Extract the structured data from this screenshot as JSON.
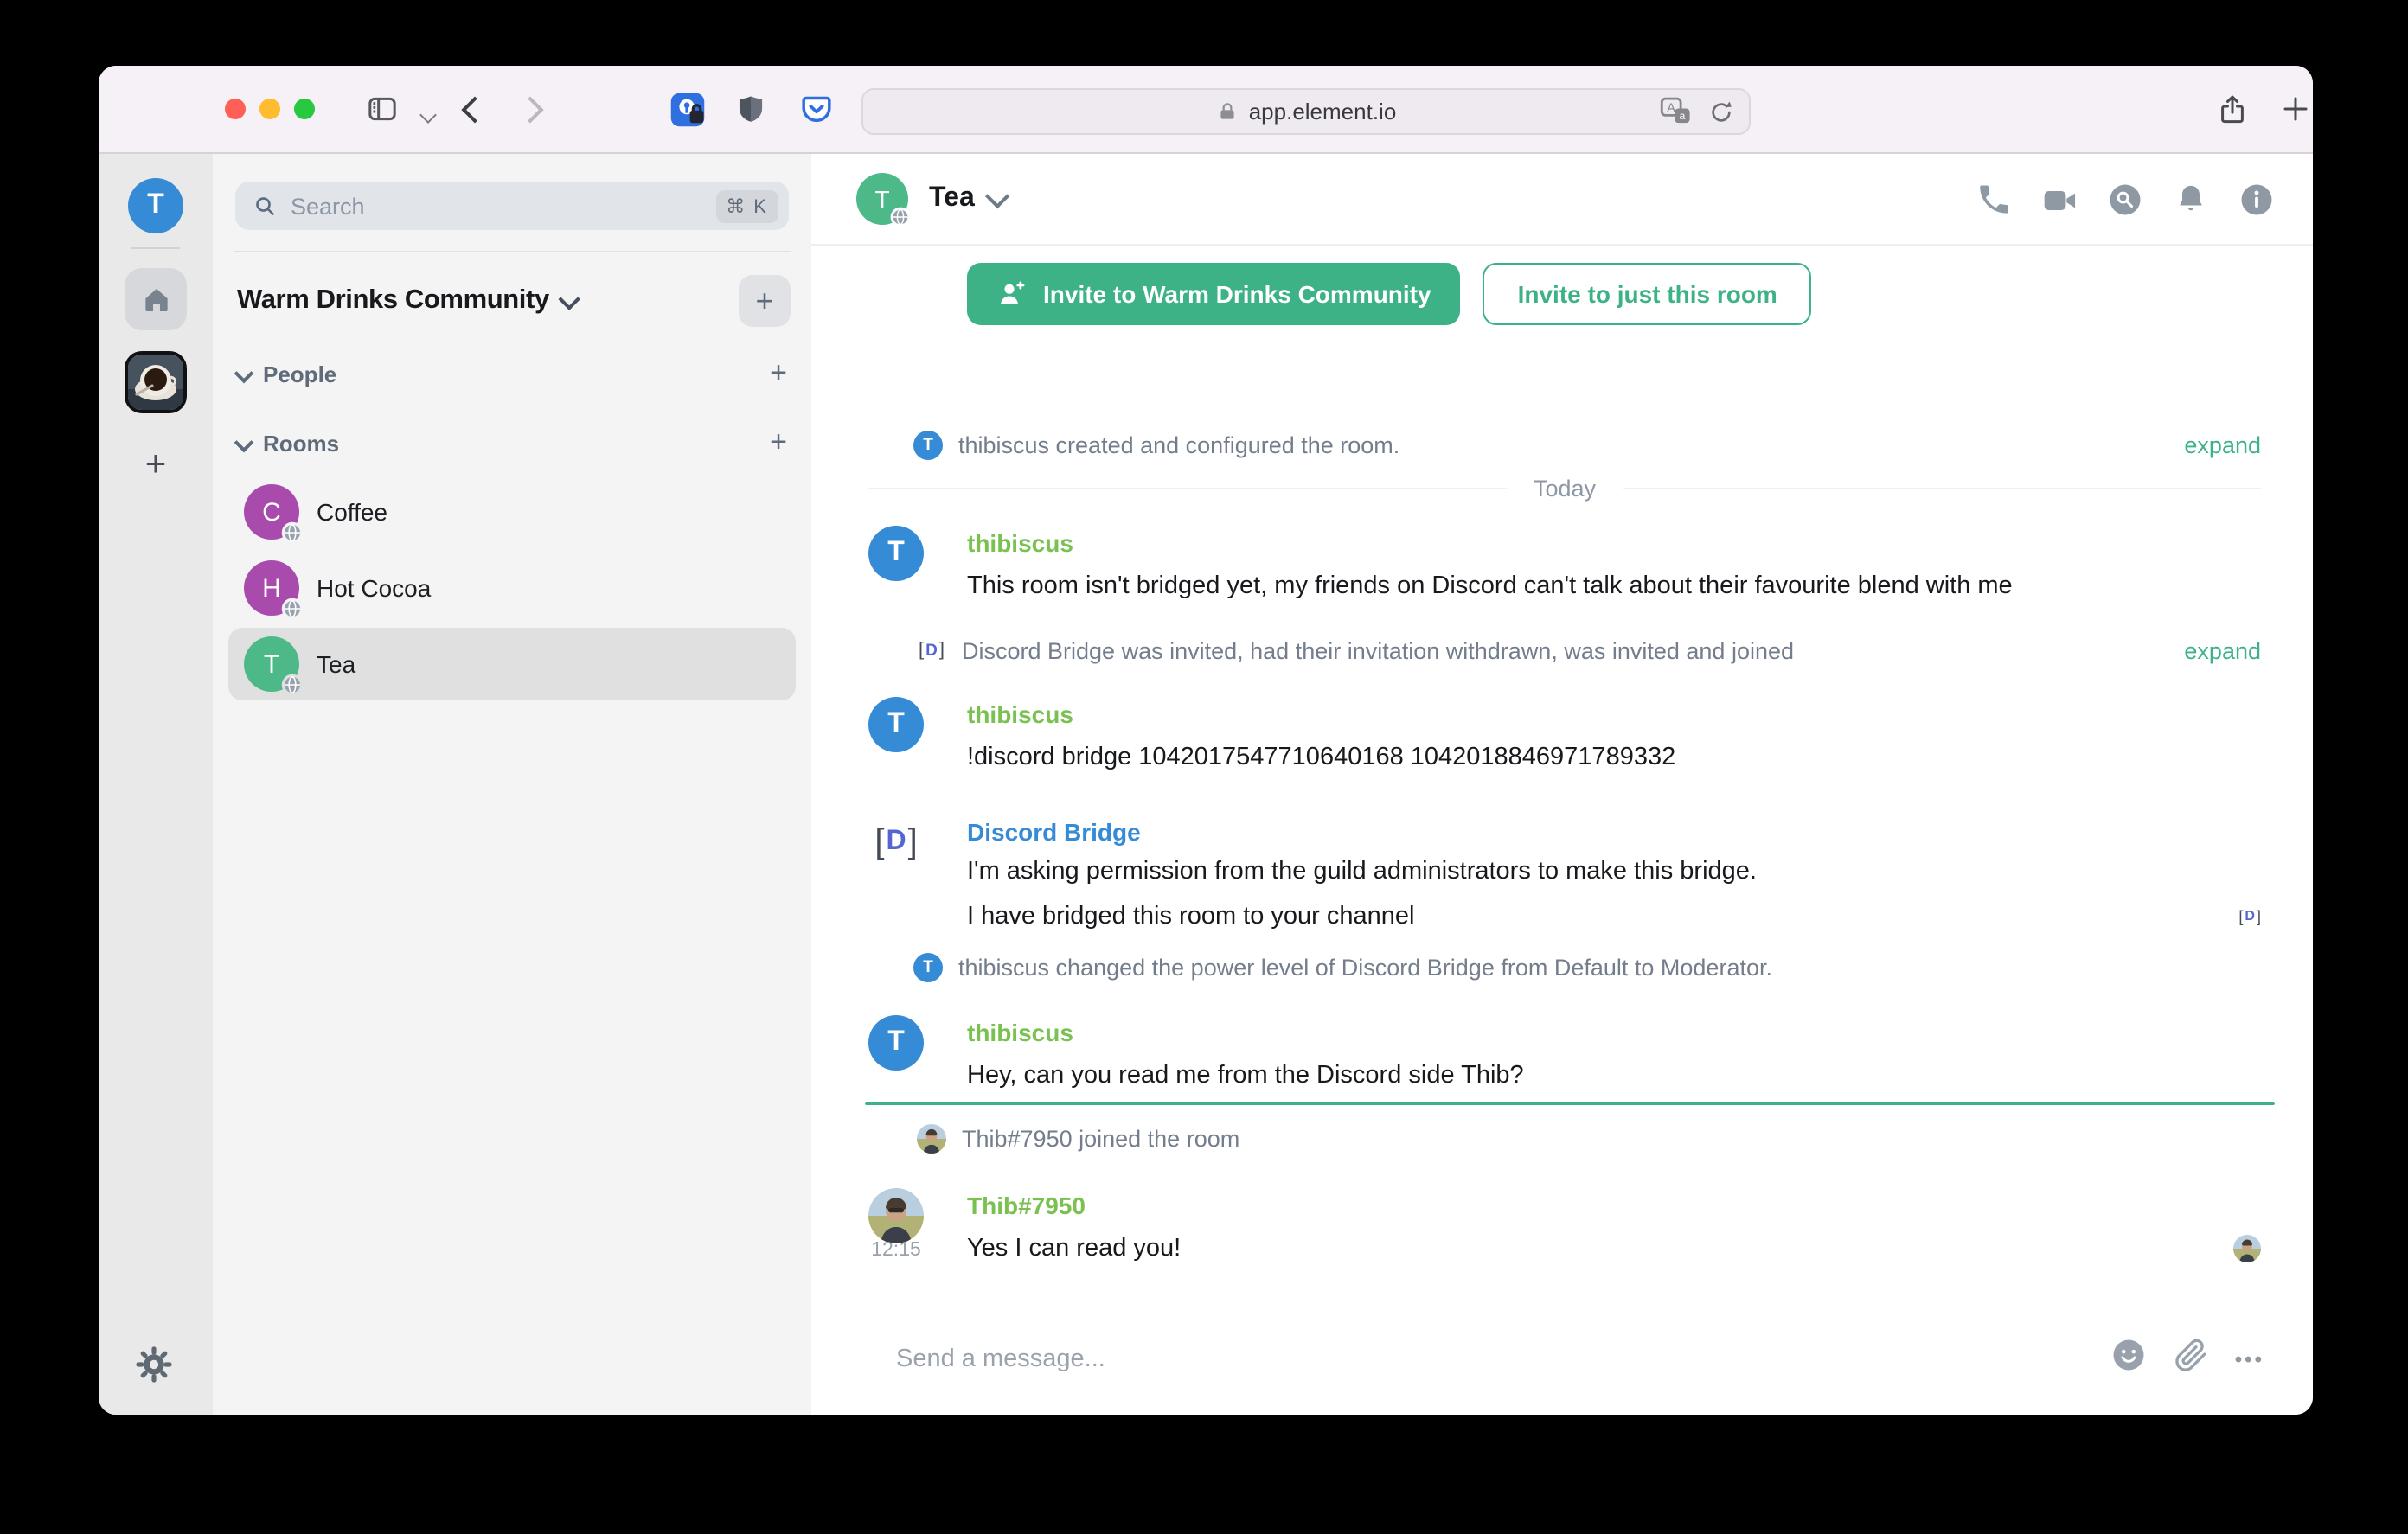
{
  "colors": {
    "accent_green": "#3eb287",
    "username_green": "#7ac152",
    "username_blue": "#368bd6",
    "avatar_blue": "#368bd6",
    "avatar_purple": "#a84bad",
    "avatar_green": "#4db989",
    "traffic_red": "#ff5f57",
    "traffic_yellow": "#febc2e",
    "traffic_green": "#28c840"
  },
  "glyphs": {
    "plus": "+",
    "bracket_open": "[",
    "bracket_close": "]",
    "discord_letter": "D",
    "more": "•••"
  },
  "browser": {
    "url": "app.element.io"
  },
  "space_bar": {
    "user_initial": "T"
  },
  "room_panel": {
    "search_placeholder": "Search",
    "search_shortcut": "⌘ K",
    "community_name": "Warm Drinks Community",
    "sections": [
      {
        "label": "People"
      },
      {
        "label": "Rooms"
      }
    ],
    "rooms": [
      {
        "name": "Coffee",
        "initial": "C"
      },
      {
        "name": "Hot Cocoa",
        "initial": "H"
      },
      {
        "name": "Tea",
        "initial": "T"
      }
    ]
  },
  "chat": {
    "room_name": "Tea",
    "room_avatar_initial": "T",
    "invite_primary": "Invite to Warm Drinks Community",
    "invite_secondary": "Invite to just this room",
    "timeline": [
      {
        "type": "event",
        "avatar_initial": "T",
        "text": "thibiscus created and configured the room.",
        "action": "expand"
      },
      {
        "type": "date",
        "label": "Today"
      },
      {
        "type": "message",
        "sender": "thibiscus",
        "avatar_initial": "T",
        "text": "This room isn't bridged yet, my friends on Discord can't talk about their favourite blend with me"
      },
      {
        "type": "event",
        "avatar": "discord",
        "text": "Discord Bridge was invited, had their invitation withdrawn, was invited and joined",
        "action": "expand"
      },
      {
        "type": "message",
        "sender": "thibiscus",
        "avatar_initial": "T",
        "text": "!discord bridge 1042017547710640168 1042018846971789332"
      },
      {
        "type": "message",
        "sender": "Discord Bridge",
        "avatar": "discord",
        "lines": [
          "I'm asking permission from the guild administrators to make this bridge.",
          "I have bridged this room to your channel"
        ]
      },
      {
        "type": "event",
        "avatar_initial": "T",
        "text": "thibiscus changed the power level of Discord Bridge from Default to Moderator."
      },
      {
        "type": "message",
        "sender": "thibiscus",
        "avatar_initial": "T",
        "text": "Hey, can you read me from the Discord side Thib?"
      },
      {
        "type": "unread_marker"
      },
      {
        "type": "event",
        "avatar": "photo",
        "text": "Thib#7950 joined the room"
      },
      {
        "type": "message",
        "sender": "Thib#7950",
        "avatar": "photo",
        "time": "12:15",
        "text": "Yes I can read you!"
      }
    ],
    "composer_placeholder": "Send a message..."
  }
}
